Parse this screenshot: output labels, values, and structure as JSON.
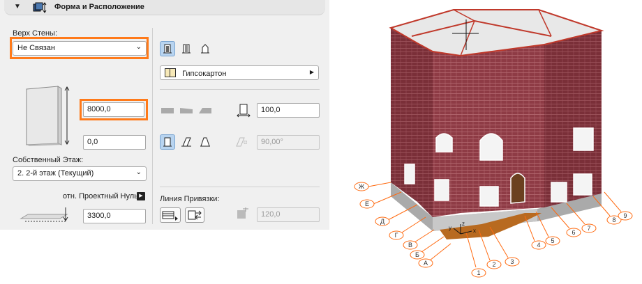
{
  "panel": {
    "title": "Форма и Расположение",
    "top_of_wall_label": "Верх Стены:",
    "top_of_wall_value": "Не Связан",
    "height_value": "8000,0",
    "offset_value": "0,0",
    "home_story_label": "Собственный Этаж:",
    "home_story_value": "2. 2-й этаж (Текущий)",
    "relative_label": "отн. Проектный Нуль",
    "base_value": "3300,0",
    "composite_value": "Гипсокартон",
    "thickness_value": "100,0",
    "angle_value": "90,00°",
    "ref_line_label": "Линия Привязки:",
    "ref_offset_value": "120,0"
  },
  "icons": {
    "header": "wall-settings-icon",
    "collapse": "triangle-down-icon",
    "composite": "composite-structure-icon"
  },
  "scene": {
    "axes_letters": [
      "Ж",
      "Е",
      "Д",
      "Г",
      "В",
      "Б",
      "А"
    ],
    "axes_numbers": [
      "1",
      "2",
      "3",
      "4",
      "5",
      "6",
      "7",
      "8",
      "9"
    ],
    "axis_labels": [
      "x",
      "y",
      "z"
    ]
  },
  "colors": {
    "highlight": "#ff7a1a",
    "selected_button": "#b8d4f0",
    "brick": "#8a3a42",
    "grid": "#ff6a10"
  }
}
